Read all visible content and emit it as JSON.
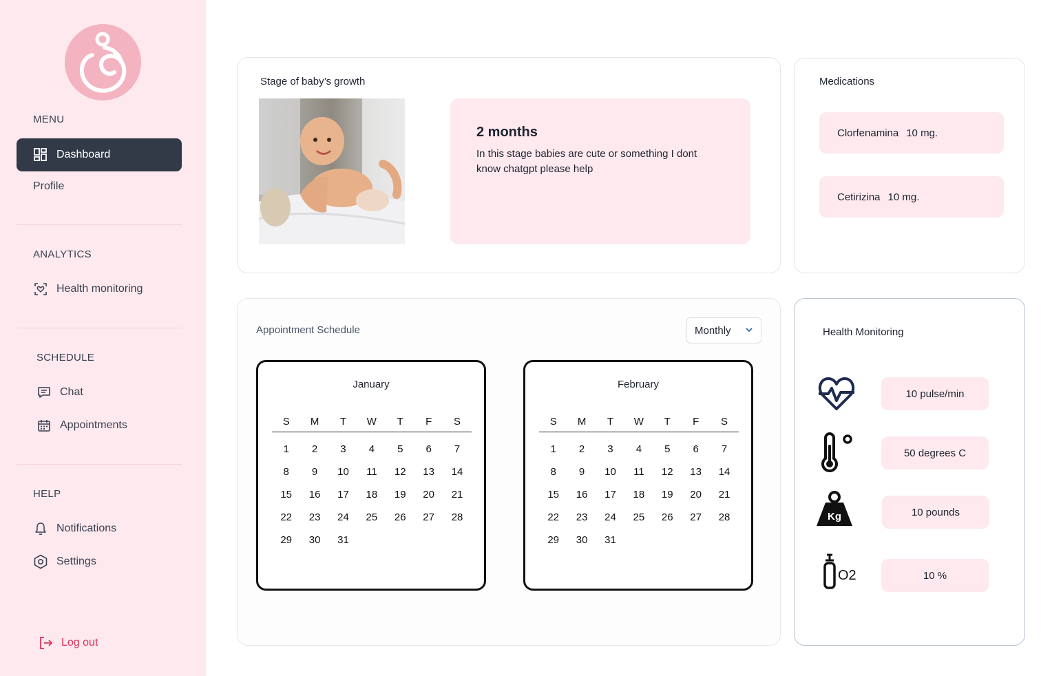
{
  "sidebar": {
    "menu_label": "MENU",
    "items_menu": [
      {
        "label": "Dashboard",
        "icon": "dashboard-grid-icon"
      },
      {
        "label": "Profile"
      }
    ],
    "analytics_label": "ANALYTICS",
    "items_analytics": [
      {
        "label": "Health monitoring",
        "icon": "heart-scan-icon"
      }
    ],
    "schedule_label": "SCHEDULE",
    "items_schedule": [
      {
        "label": "Chat",
        "icon": "chat-icon"
      },
      {
        "label": "Appointments",
        "icon": "calendar-icon"
      }
    ],
    "help_label": "HELP",
    "items_help": [
      {
        "label": "Notifications",
        "icon": "bell-icon"
      },
      {
        "label": "Settings",
        "icon": "hexagon-gear-icon"
      }
    ],
    "logout_label": "Log out"
  },
  "growth": {
    "title": "Stage of baby’s growth",
    "stage_title": "2 months",
    "stage_text": "In this stage babies are cute or something I dont know chatgpt please help"
  },
  "medications": {
    "title": "Medications",
    "items": [
      {
        "name": "Clorfenamina",
        "dose": "10 mg."
      },
      {
        "name": "Cetirizina",
        "dose": "10 mg."
      }
    ]
  },
  "schedule": {
    "title": "Appointment Schedule",
    "period": "Monthly",
    "weekdays": [
      "S",
      "M",
      "T",
      "W",
      "T",
      "F",
      "S"
    ],
    "months": [
      {
        "name": "January",
        "days": 31
      },
      {
        "name": "February",
        "days": 31
      }
    ]
  },
  "health": {
    "title": "Health Monitoring",
    "metrics": [
      {
        "icon": "heartbeat-icon",
        "value": "10 pulse/min"
      },
      {
        "icon": "thermometer-icon",
        "value": "50 degrees C"
      },
      {
        "icon": "weight-icon",
        "value": "10 pounds",
        "icon_text": "Kg"
      },
      {
        "icon": "oxygen-tank-icon",
        "value": "10 %",
        "icon_text": "O2"
      }
    ]
  },
  "colors": {
    "sidebar_bg": "#fde9ee",
    "accent_pink": "#f4b3c0",
    "active_nav": "#323a47",
    "logout": "#e0345a"
  }
}
